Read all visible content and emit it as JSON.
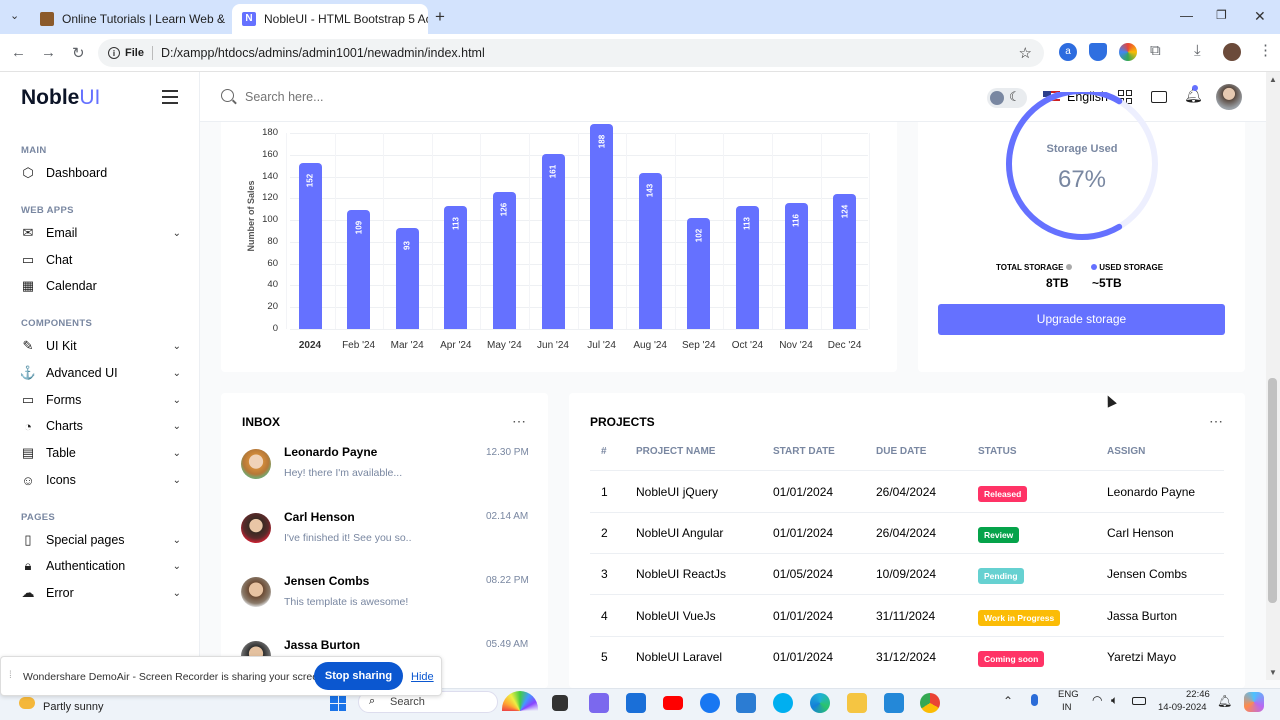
{
  "browser": {
    "tabs": [
      {
        "title": "Online Tutorials | Learn Web &",
        "active": false
      },
      {
        "title": "NobleUI - HTML Bootstrap 5 Ac",
        "active": true
      }
    ],
    "new_tab_label": "+",
    "file_label": "File",
    "url": "D:/xampp/htdocs/admins/admin1001/newadmin/index.html"
  },
  "brand": {
    "noble": "Noble",
    "ui": "UI"
  },
  "search": {
    "placeholder": "Search here..."
  },
  "topbar": {
    "language": "English"
  },
  "sidebar": {
    "sections": [
      {
        "title": "MAIN",
        "items": [
          {
            "label": "Dashboard",
            "icon": "box-icon",
            "chevron": false
          }
        ]
      },
      {
        "title": "WEB APPS",
        "items": [
          {
            "label": "Email",
            "icon": "mail-icon",
            "chevron": true
          },
          {
            "label": "Chat",
            "icon": "chat-icon",
            "chevron": false
          },
          {
            "label": "Calendar",
            "icon": "calendar-icon",
            "chevron": false
          }
        ]
      },
      {
        "title": "COMPONENTS",
        "items": [
          {
            "label": "UI Kit",
            "icon": "feather-icon",
            "chevron": true
          },
          {
            "label": "Advanced UI",
            "icon": "anchor-icon",
            "chevron": true
          },
          {
            "label": "Forms",
            "icon": "inbox-icon",
            "chevron": true
          },
          {
            "label": "Charts",
            "icon": "pie-chart-icon",
            "chevron": true
          },
          {
            "label": "Table",
            "icon": "layout-icon",
            "chevron": true
          },
          {
            "label": "Icons",
            "icon": "smile-icon",
            "chevron": true
          }
        ]
      },
      {
        "title": "PAGES",
        "items": [
          {
            "label": "Special pages",
            "icon": "book-icon",
            "chevron": true
          },
          {
            "label": "Authentication",
            "icon": "lock-icon",
            "chevron": true
          },
          {
            "label": "Error",
            "icon": "cloud-off-icon",
            "chevron": true
          }
        ]
      }
    ]
  },
  "chart_data": {
    "type": "bar",
    "ylabel": "Number of Sales",
    "categories": [
      "2024",
      "Feb '24",
      "Mar '24",
      "Apr '24",
      "May '24",
      "Jun '24",
      "Jul '24",
      "Aug '24",
      "Sep '24",
      "Oct '24",
      "Nov '24",
      "Dec '24"
    ],
    "values": [
      152,
      109,
      93,
      113,
      126,
      161,
      188,
      143,
      102,
      113,
      116,
      124
    ],
    "yticks": [
      0,
      20,
      40,
      60,
      80,
      100,
      120,
      140,
      160,
      180
    ],
    "ylim": [
      0,
      190
    ],
    "grid": true,
    "color": "#6571ff"
  },
  "storage": {
    "title": "Storage Used",
    "percent_text": "67%",
    "percent": 0.67,
    "total_label": "TOTAL STORAGE",
    "total_value": "8TB",
    "used_label": "USED STORAGE",
    "used_value": "~5TB",
    "button": "Upgrade storage"
  },
  "inbox": {
    "title": "INBOX",
    "messages": [
      {
        "name": "Leonardo Payne",
        "text": "Hey! there I'm available...",
        "time": "12.30 PM"
      },
      {
        "name": "Carl Henson",
        "text": "I've finished it! See you so..",
        "time": "02.14 AM"
      },
      {
        "name": "Jensen Combs",
        "text": "This template is awesome!",
        "time": "08.22 PM"
      },
      {
        "name": "Jassa Burton",
        "text": "",
        "time": "05.49 AM"
      }
    ]
  },
  "projects": {
    "title": "PROJECTS",
    "columns": [
      "#",
      "PROJECT NAME",
      "START DATE",
      "DUE DATE",
      "STATUS",
      "ASSIGN"
    ],
    "rows": [
      {
        "n": "1",
        "name": "NobleUI jQuery",
        "start": "01/01/2024",
        "due": "26/04/2024",
        "status": "Released",
        "color": "#ff3366",
        "assign": "Leonardo Payne"
      },
      {
        "n": "2",
        "name": "NobleUI Angular",
        "start": "01/01/2024",
        "due": "26/04/2024",
        "status": "Review",
        "color": "#05a34a",
        "assign": "Carl Henson"
      },
      {
        "n": "3",
        "name": "NobleUI ReactJs",
        "start": "01/05/2024",
        "due": "10/09/2024",
        "status": "Pending",
        "color": "#66d1d1",
        "assign": "Jensen Combs"
      },
      {
        "n": "4",
        "name": "NobleUI VueJs",
        "start": "01/01/2024",
        "due": "31/11/2024",
        "status": "Work in Progress",
        "color": "#fbbc06",
        "assign": "Jassa Burton"
      },
      {
        "n": "5",
        "name": "NobleUI Laravel",
        "start": "01/01/2024",
        "due": "31/12/2024",
        "status": "Coming soon",
        "color": "#ff3366",
        "assign": "Yaretzi Mayo"
      }
    ]
  },
  "share_bar": {
    "text": "Wondershare DemoAir - Screen Recorder is sharing your screen.",
    "stop": "Stop sharing",
    "hide": "Hide"
  },
  "taskbar": {
    "weather": "Partly sunny",
    "search": "Search",
    "lang1": "ENG",
    "lang2": "IN",
    "time": "22:46",
    "date": "14-09-2024"
  }
}
